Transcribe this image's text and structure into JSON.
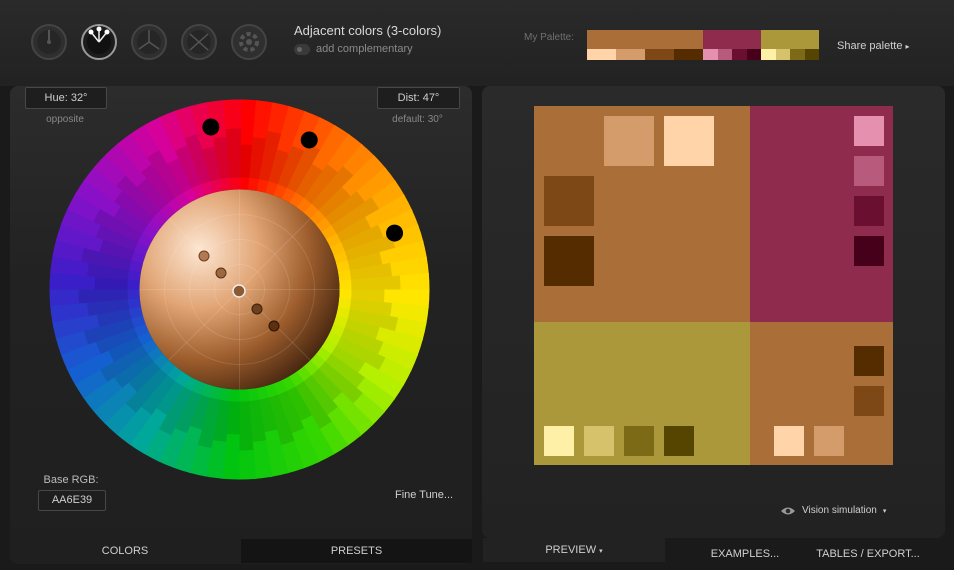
{
  "header": {
    "scheme_title": "Adjacent colors (3-colors)",
    "add_complementary": "add complementary",
    "scheme_icons": [
      "mono-scheme-icon",
      "adjacent-scheme-icon",
      "triad-scheme-icon",
      "tetrad-scheme-icon",
      "freestyle-scheme-icon"
    ],
    "my_palette_label": "My Palette:",
    "share_palette": "Share palette",
    "palette": [
      {
        "main": "#AA6E39",
        "subs": [
          "#FFD4A8",
          "#D49C6A",
          "#7E4716",
          "#552B00"
        ]
      },
      {
        "main": "#8F2C4E",
        "subs": [
          "#E490AE",
          "#B85A7C",
          "#6A0F2F",
          "#470019"
        ]
      },
      {
        "main": "#AA983A",
        "subs": [
          "#FFF0A8",
          "#D5C26B",
          "#7D6A16",
          "#554500"
        ]
      }
    ]
  },
  "controls": {
    "hue_label": "Hue: 32°",
    "hue_sub": "opposite",
    "dist_label": "Dist: 47°",
    "dist_sub": "default: 30°",
    "base_rgb_label": "Base RGB:",
    "base_rgb_value": "AA6E39",
    "fine_tune": "Fine Tune..."
  },
  "wheel": {
    "hue_dots": [
      {
        "hue": 350,
        "color": "#000000"
      },
      {
        "hue": 25,
        "color": "#000000"
      },
      {
        "hue": 70,
        "color": "#000000"
      }
    ]
  },
  "tabs": {
    "colors": "COLORS",
    "presets": "PRESETS",
    "preview": "PREVIEW",
    "examples": "EXAMPLES...",
    "tables": "TABLES / EXPORT..."
  },
  "preview": {
    "vision_simulation": "Vision simulation"
  }
}
